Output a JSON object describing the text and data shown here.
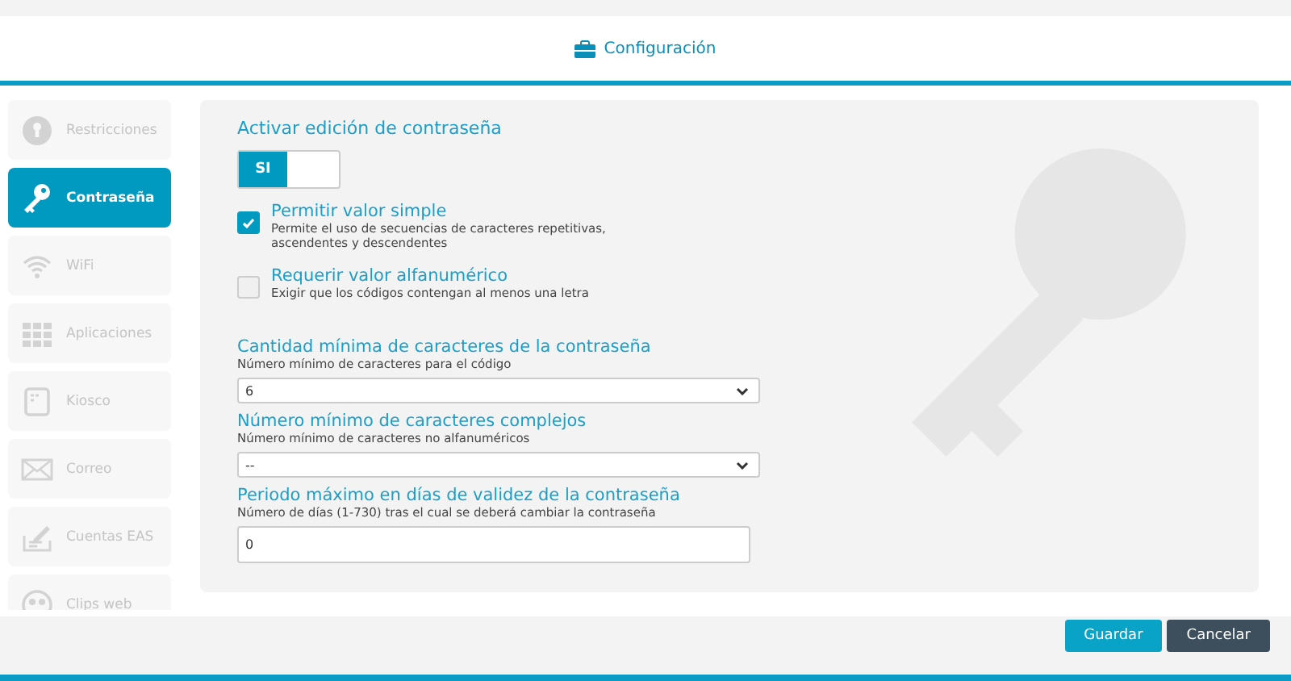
{
  "header": {
    "title": "Configuración"
  },
  "sidebar": {
    "items": [
      {
        "label": "Restricciones",
        "kind": "restrict",
        "selected": false
      },
      {
        "label": "Contraseña",
        "kind": "key",
        "selected": true
      },
      {
        "label": "WiFi",
        "kind": "wifi",
        "selected": false
      },
      {
        "label": "Aplicaciones",
        "kind": "apps",
        "selected": false
      },
      {
        "label": "Kiosco",
        "kind": "kiosk",
        "selected": false
      },
      {
        "label": "Correo",
        "kind": "mail",
        "selected": false
      },
      {
        "label": "Cuentas EAS",
        "kind": "eas",
        "selected": false
      },
      {
        "label": "Clips web",
        "kind": "clips",
        "selected": false
      }
    ]
  },
  "panel": {
    "title": "Activar edición de contraseña",
    "toggle": {
      "label": "SI",
      "on": true
    },
    "options": [
      {
        "label": "Permitir valor simple",
        "description": "Permite el uso de secuencias de caracteres repetitivas,\nascendentes y descendentes",
        "checked": true
      },
      {
        "label": "Requerir valor alfanumérico",
        "description": "Exigir que los códigos contengan al menos una letra",
        "checked": false
      }
    ],
    "fields": [
      {
        "kind": "select",
        "label": "Cantidad mínima de caracteres de la contraseña",
        "hint": "Número mínimo de caracteres para el código",
        "value": "6"
      },
      {
        "kind": "select",
        "label": "Número mínimo de caracteres complejos",
        "hint": "Número mínimo de caracteres no alfanuméricos",
        "value": "--"
      },
      {
        "kind": "input",
        "label": "Periodo máximo en días de validez de la contraseña",
        "hint": "Número de días (1-730) tras el cual se deberá cambiar la contraseña",
        "value": "0"
      }
    ]
  },
  "buttons": [
    {
      "label": "Guardar",
      "kind": "primary"
    },
    {
      "label": "Cancelar",
      "kind": "secondary"
    }
  ]
}
